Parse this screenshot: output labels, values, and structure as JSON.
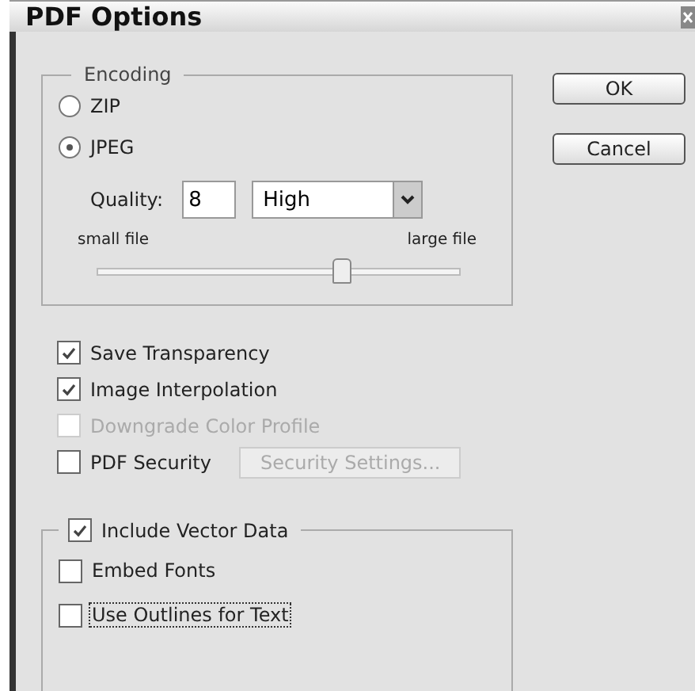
{
  "window": {
    "title": "PDF Options"
  },
  "encoding": {
    "label": "Encoding",
    "options": [
      {
        "label": "ZIP",
        "selected": false
      },
      {
        "label": "JPEG",
        "selected": true
      }
    ],
    "quality": {
      "label": "Quality:",
      "value": "8",
      "preset": "High"
    },
    "slider": {
      "min_label": "small file",
      "max_label": "large file",
      "level": 0.67
    }
  },
  "buttons": [
    {
      "label": "OK"
    },
    {
      "label": "Cancel"
    }
  ],
  "options": [
    {
      "label": "Save Transparency",
      "checked": true,
      "disabled": false
    },
    {
      "label": "Image Interpolation",
      "checked": true,
      "disabled": false
    },
    {
      "label": "Downgrade Color Profile",
      "checked": false,
      "disabled": true
    }
  ],
  "security": {
    "label": "PDF Security",
    "checked": false,
    "button": {
      "label": "Security Settings...",
      "disabled": true
    }
  },
  "vector": {
    "label": "Include Vector Data",
    "checked": true,
    "options": [
      {
        "label": "Embed Fonts",
        "checked": false,
        "focused": false
      },
      {
        "label": "Use Outlines for Text",
        "checked": false,
        "focused": true
      }
    ]
  }
}
